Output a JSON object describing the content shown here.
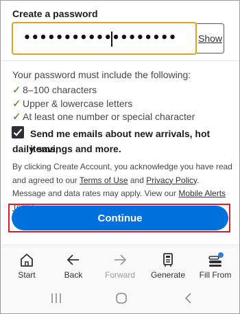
{
  "form": {
    "label": "Create a password",
    "password_value": "•••••••••••••••••••",
    "show_label": "Show"
  },
  "requirements": {
    "intro": "Your password must include the following:",
    "items": [
      "8–100 characters",
      "Upper & lowercase letters",
      "At least one number or special character"
    ],
    "check_glyph": "✓"
  },
  "emails_opt_in": {
    "checked": true,
    "label_line1": "Send me emails about new arrivals, hot items,",
    "label_line2": "daily savings and more."
  },
  "legal": {
    "text1": "By clicking Create Account, you acknowledge you have read and agreed to our ",
    "terms_link": "Terms of Use",
    "text2": " and ",
    "privacy_link": "Privacy Policy",
    "text3": ". Message and data rates may apply. View our ",
    "alerts_link": "Mobile Alerts Terms",
    "text4": "."
  },
  "continue_label": "Continue",
  "bottom_nav": {
    "items": [
      {
        "label": "Start",
        "icon": "home-icon"
      },
      {
        "label": "Back",
        "icon": "arrow-left-icon"
      },
      {
        "label": "Forward",
        "icon": "arrow-right-icon"
      },
      {
        "label": "Generate",
        "icon": "password-generator-icon"
      },
      {
        "label": "Fill From",
        "icon": "fill-from-icon"
      }
    ]
  },
  "colors": {
    "accent": "#0071dc",
    "check": "#2a8703",
    "focus_border": "#e0a11b",
    "highlight_frame": "#de1c24"
  },
  "system_nav": [
    "recent-apps-icon",
    "home-circle-icon",
    "back-chevron-icon"
  ]
}
